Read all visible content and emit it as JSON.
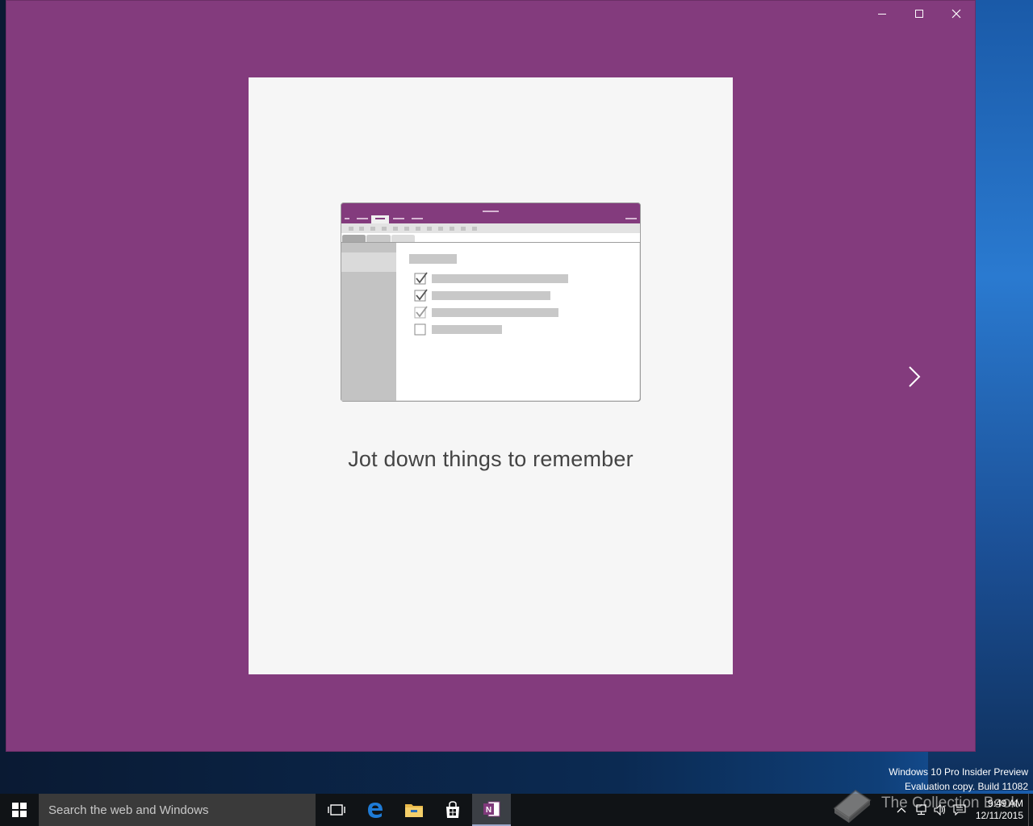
{
  "window": {
    "background": "#833b7d",
    "controls": {
      "minimize": "minimize-icon",
      "maximize": "maximize-icon",
      "close": "close-icon"
    }
  },
  "onboarding": {
    "caption": "Jot down things to remember",
    "illustration": {
      "checklist_state": [
        true,
        true,
        true,
        false
      ]
    },
    "next_icon": "chevron-right-icon"
  },
  "watermark": {
    "line1": "Windows 10 Pro Insider Preview",
    "line2": "Evaluation copy. Build 11082"
  },
  "taskbar": {
    "search_placeholder": "Search the web and Windows",
    "apps": [
      "start-icon",
      "task-view-icon",
      "edge-icon",
      "file-explorer-icon",
      "store-icon",
      "onenote-icon"
    ],
    "active_app": "onenote-icon",
    "time": "9:49 AM",
    "date": "12/11/2015"
  },
  "overlay": {
    "text": "The Collection Book"
  }
}
